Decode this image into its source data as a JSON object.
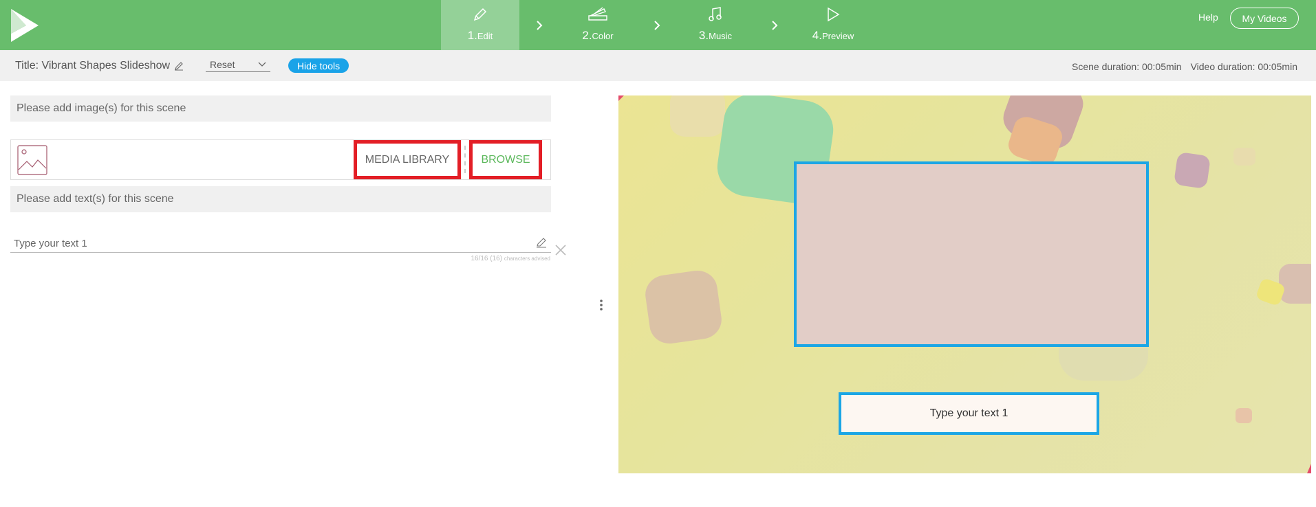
{
  "header": {
    "steps": [
      {
        "num": "1.",
        "label": "Edit",
        "icon": "pencil-icon",
        "active": true
      },
      {
        "num": "2.",
        "label": "Color",
        "icon": "palette-icon",
        "active": false
      },
      {
        "num": "3.",
        "label": "Music",
        "icon": "music-note-icon",
        "active": false
      },
      {
        "num": "4.",
        "label": "Preview",
        "icon": "play-icon",
        "active": false
      }
    ],
    "help_label": "Help",
    "my_videos_label": "My Videos",
    "logo_icon": "app-logo-icon",
    "brand_color": "#68bd6c"
  },
  "toolbar": {
    "title": "Title: Vibrant Shapes Slideshow",
    "reset_label": "Reset",
    "hide_tools_label": "Hide tools",
    "scene_duration": "Scene duration:  00:05min",
    "video_duration": "Video duration: 00:05min"
  },
  "editor": {
    "images_heading": "Please add image(s) for this scene",
    "media_library_label": "MEDIA LIBRARY",
    "browse_label": "BROWSE",
    "texts_heading": "Please add text(s) for this scene",
    "text_field_value": "Type your text 1",
    "char_count": "16/16 (16)",
    "char_note": "characters advised"
  },
  "preview": {
    "text_placeholder": "Type your text 1",
    "highlight_color": "#1ca6e5"
  }
}
